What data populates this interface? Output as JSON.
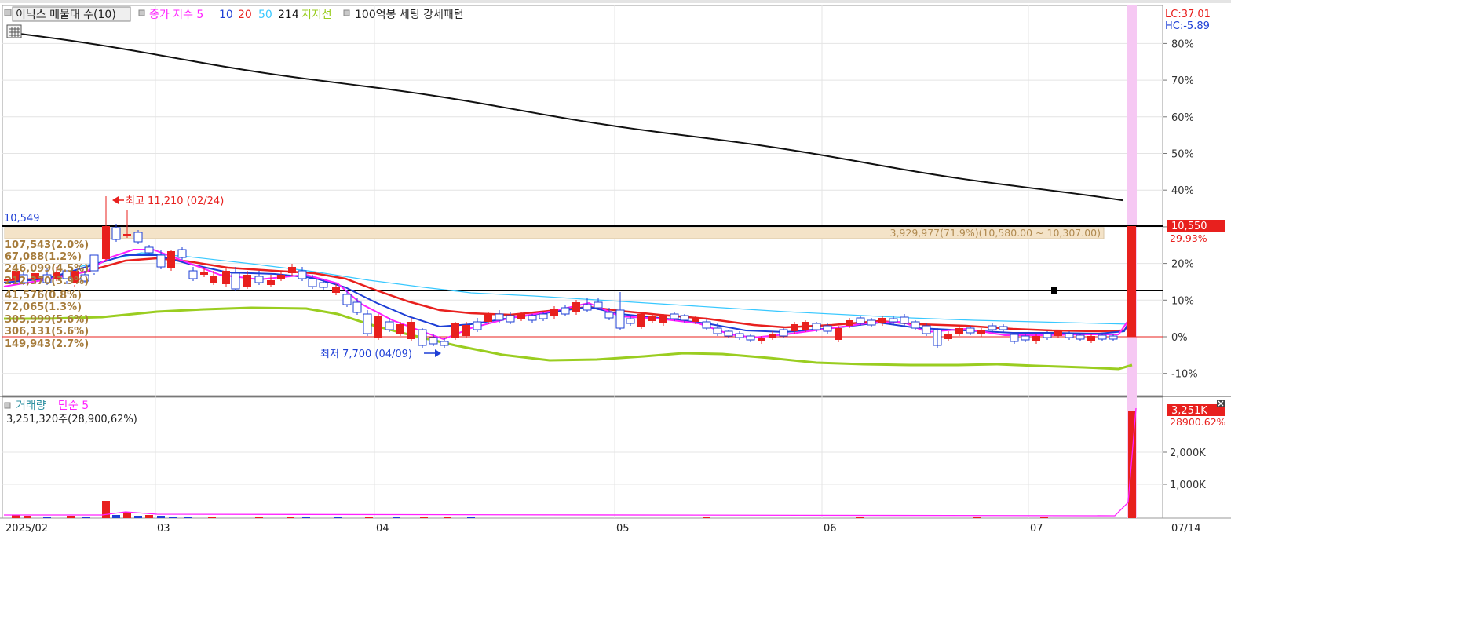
{
  "top_pane": {
    "legend": {
      "title": "이닉스 매물대 수(10)",
      "ma_label": "종가 지수 5",
      "ma10": "10",
      "ma20": "20",
      "ma50": "50",
      "ma214": "214",
      "support_label": "지지선",
      "pattern_label": "100억봉 세팅 강세패턴"
    },
    "lc": "LC:37.01",
    "hc": "HC:-5.89",
    "high_annotation": "최고 11,210 (02/24)",
    "low_annotation": "최저 7,700 (04/09)",
    "left_value": "10,549",
    "price_badge": "10,550",
    "price_badge_pct": "29.93%",
    "volume_profile_top": "3,929,977(71.9%)(10,580.00 ~ 10,307.00)",
    "volume_profile_labels": [
      "107,543(2.0%)",
      "67,088(1.2%)",
      "246,099(4.5%)",
      "212,370(3.9%)",
      "41,576(0.8%)",
      "72,065(1.3%)",
      "305,999(5.6%)",
      "306,131(5.6%)",
      "149,943(2.7%)"
    ],
    "right_axis_ticks": [
      "80%",
      "70%",
      "60%",
      "50%",
      "40%",
      "20%",
      "10%",
      "0%",
      "-10%"
    ]
  },
  "bottom_pane": {
    "legend_volume": "거래량",
    "legend_ma": "단순 5",
    "info": "3,251,320주(28,900,62%)",
    "badge": "3,251K",
    "badge_sub": "28900.62%",
    "right_axis_ticks": [
      "2,000K",
      "1,000K"
    ]
  },
  "x_axis": {
    "labels": [
      "2025/02",
      "03",
      "04",
      "05",
      "06",
      "07"
    ],
    "current_date": "07/14"
  },
  "colors": {
    "up": "#e8201e",
    "down": "#1e3fd6",
    "ma5": "#ff20ff",
    "ma10": "#1e3fd6",
    "ma20": "#e8201e",
    "ma50": "#38c8ff",
    "ma214": "#9acd20",
    "highlight": "#f6c8f3",
    "volume_profile": "#f4e3c8"
  },
  "chart_data": {
    "type": "candlestick",
    "period": "2025/02 – 2025/07/14",
    "price_axis": {
      "unit": "KRW",
      "high": 11210,
      "low": 7700,
      "last": 10550
    },
    "percent_axis": {
      "range": [
        -15,
        85
      ],
      "ticks": [
        80,
        70,
        60,
        50,
        40,
        30,
        20,
        10,
        0,
        -10
      ]
    },
    "series": [
      {
        "name": "종가 지수 5"
      },
      {
        "name": "10"
      },
      {
        "name": "20"
      },
      {
        "name": "50"
      },
      {
        "name": "214"
      },
      {
        "name": "지지선"
      }
    ],
    "support_lines": [
      10549,
      9400
    ],
    "last_volume": 3251320,
    "volume_axis_ticks": [
      "2,000K",
      "1,000K"
    ]
  }
}
